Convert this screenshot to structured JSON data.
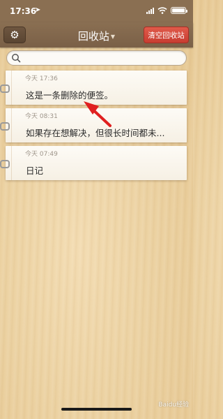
{
  "status_bar": {
    "time": "17:36",
    "location_icon": "location-arrow-icon",
    "signal_icon": "signal-bars-icon",
    "wifi_icon": "wifi-icon",
    "battery_icon": "battery-icon"
  },
  "nav": {
    "title": "回收站",
    "title_caret_icon": "chevron-down-icon",
    "settings_icon": "gear-icon",
    "clear_label": "清空回收站",
    "clear_color": "#d44a3d"
  },
  "search": {
    "placeholder": "",
    "icon": "search-icon"
  },
  "notes": [
    {
      "time": "今天 17:36",
      "text": "这是一条删除的便签。"
    },
    {
      "time": "今天 08:31",
      "text": "如果存在想解决，但很长时间都未..."
    },
    {
      "time": "今天 07:49",
      "text": "日记"
    }
  ],
  "annotation": {
    "arrow_color": "#e02020"
  },
  "watermark": {
    "text": "Baidu经验"
  }
}
